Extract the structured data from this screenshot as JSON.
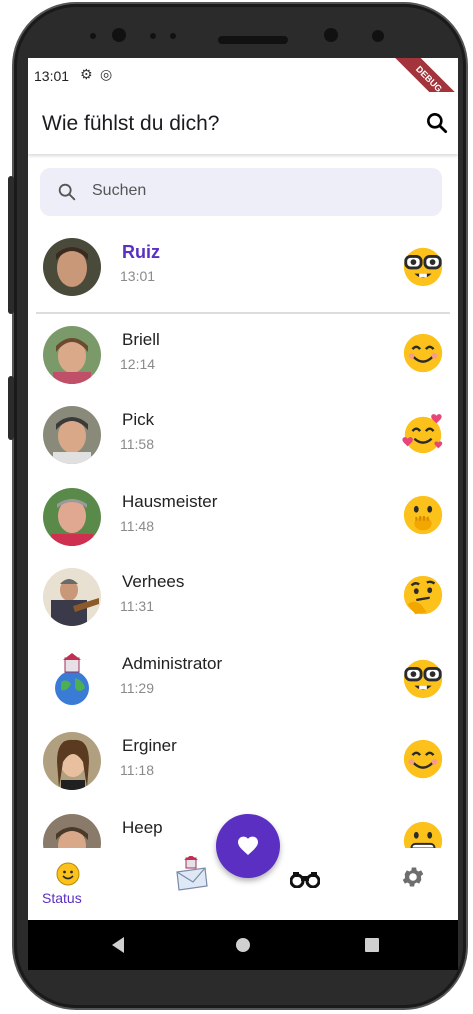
{
  "status_bar": {
    "time": "13:01",
    "debug_banner": "DEBUG"
  },
  "app_bar": {
    "title": "Wie fühlst du dich?"
  },
  "search": {
    "placeholder": "Suchen"
  },
  "me": {
    "name": "Ruiz",
    "time": "13:01",
    "emoji": "nerd-face-emoji"
  },
  "contacts": [
    {
      "name": "Briell",
      "time": "12:14",
      "emoji": "smiling-face-emoji"
    },
    {
      "name": "Pick",
      "time": "11:58",
      "emoji": "smiling-face-with-hearts-emoji"
    },
    {
      "name": "Hausmeister",
      "time": "11:48",
      "emoji": "face-with-hand-over-mouth-emoji"
    },
    {
      "name": "Verhees",
      "time": "11:31",
      "emoji": "thinking-face-emoji"
    },
    {
      "name": "Administrator",
      "time": "11:29",
      "emoji": "nerd-face-emoji"
    },
    {
      "name": "Erginer",
      "time": "11:18",
      "emoji": "smiling-face-emoji"
    },
    {
      "name": "Heep",
      "time": "",
      "emoji": "grimacing-face-emoji"
    }
  ],
  "bottom_nav": {
    "status_label": "Status",
    "items": [
      "status-icon",
      "mail-icon",
      "binoculars-icon",
      "settings-icon"
    ]
  },
  "colors": {
    "accent": "#5a2fc2",
    "search_bg": "#eeeef8",
    "time_gray": "#8a8a8a"
  }
}
